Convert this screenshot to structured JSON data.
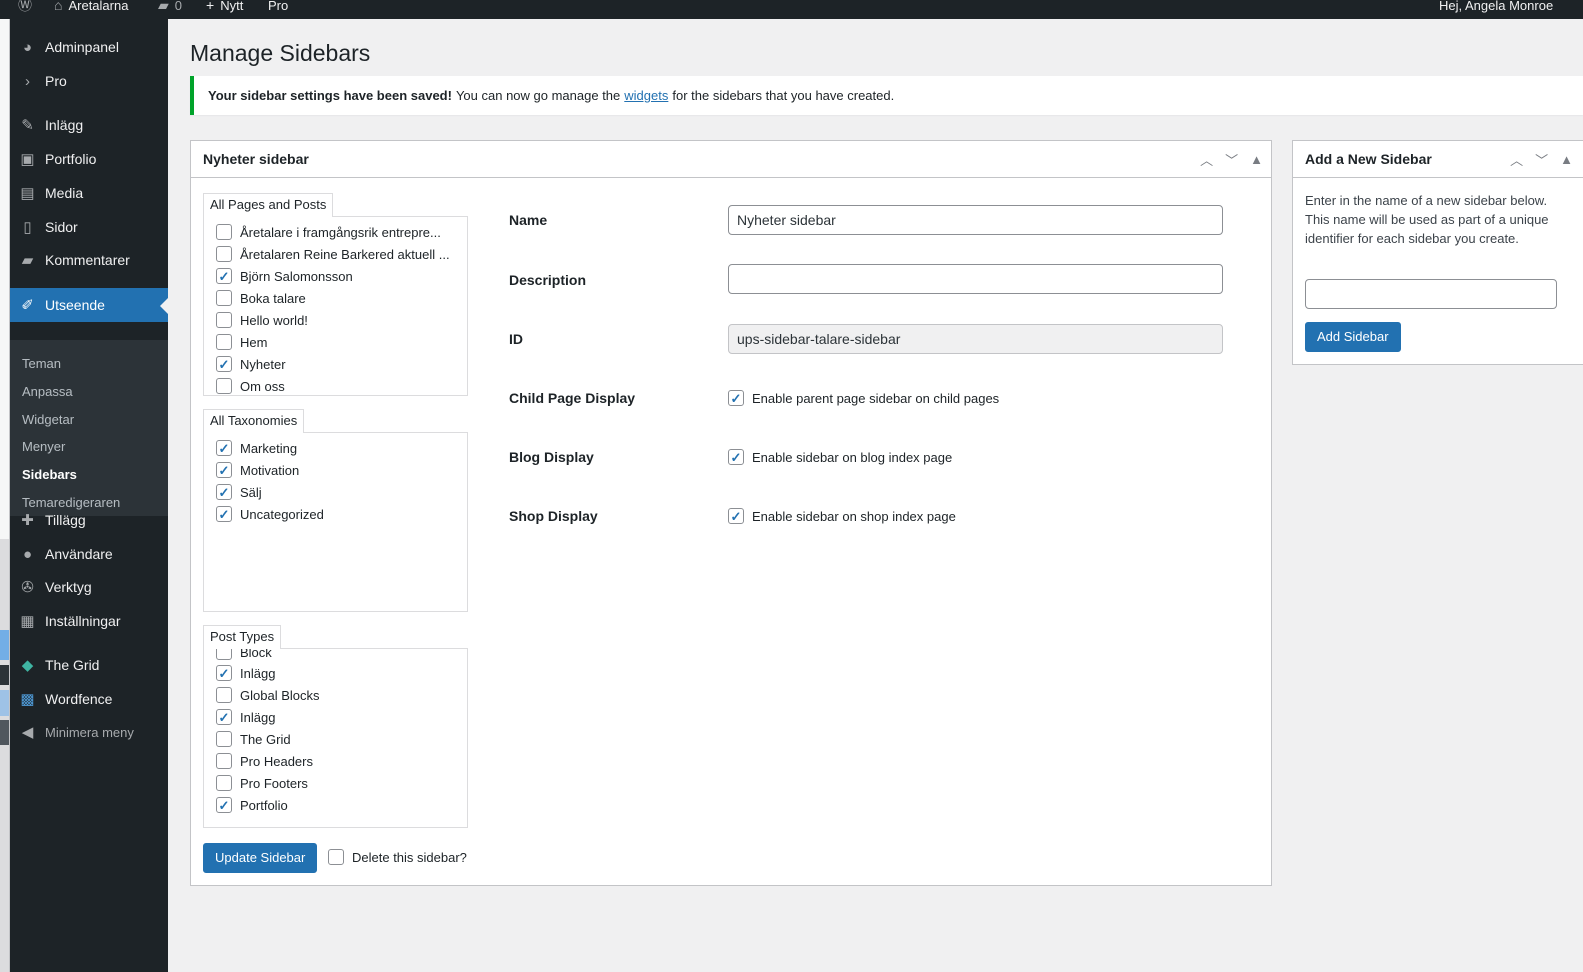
{
  "adminbar": {
    "site_name": "Aretalarna",
    "comments_count": "0",
    "new_label": "Nytt",
    "pro_label": "Pro",
    "greeting": "Hej, Angela Monroe"
  },
  "menu": {
    "items": [
      {
        "label": "Adminpanel",
        "icon": "dashboard-icon"
      },
      {
        "label": "Pro",
        "icon": "chevron-right-icon"
      },
      {
        "label": "Inlägg",
        "icon": "pin-icon"
      },
      {
        "label": "Portfolio",
        "icon": "portfolio-icon"
      },
      {
        "label": "Media",
        "icon": "media-icon"
      },
      {
        "label": "Sidor",
        "icon": "pages-icon"
      },
      {
        "label": "Kommentarer",
        "icon": "comment-icon"
      },
      {
        "label": "Utseende",
        "icon": "brush-icon"
      },
      {
        "label": "Tillägg",
        "icon": "plugin-icon"
      },
      {
        "label": "Användare",
        "icon": "user-icon"
      },
      {
        "label": "Verktyg",
        "icon": "wrench-icon"
      },
      {
        "label": "Inställningar",
        "icon": "settings-icon"
      },
      {
        "label": "The Grid",
        "icon": "grid-icon"
      },
      {
        "label": "Wordfence",
        "icon": "wordfence-icon"
      },
      {
        "label": "Minimera meny",
        "icon": "collapse-icon"
      }
    ],
    "submenu": [
      "Teman",
      "Anpassa",
      "Widgetar",
      "Menyer",
      "Sidebars",
      "Temaredigeraren"
    ],
    "active_submenu": "Sidebars"
  },
  "page": {
    "title": "Manage Sidebars"
  },
  "notice": {
    "bold": "Your sidebar settings have been saved!",
    "text_before": "You can now go manage the",
    "link": "widgets",
    "text_after": "for the sidebars that you have created."
  },
  "sidebar_box": {
    "title": "Nyheter sidebar",
    "pages_label": "All Pages and Posts",
    "pages": [
      {
        "label": "Åretalare i framgångsrik entrepre...",
        "checked": false
      },
      {
        "label": "Åretalaren Reine Barkered aktuell ...",
        "checked": false
      },
      {
        "label": "Björn Salomonsson",
        "checked": true
      },
      {
        "label": "Boka talare",
        "checked": false
      },
      {
        "label": "Hello world!",
        "checked": false
      },
      {
        "label": "Hem",
        "checked": false
      },
      {
        "label": "Nyheter",
        "checked": true
      },
      {
        "label": "Om oss",
        "checked": false
      }
    ],
    "taxonomies_label": "All Taxonomies",
    "taxonomies": [
      {
        "label": "Marketing",
        "checked": true
      },
      {
        "label": "Motivation",
        "checked": true
      },
      {
        "label": "Sälj",
        "checked": true
      },
      {
        "label": "Uncategorized",
        "checked": true
      }
    ],
    "post_types_label": "Post Types",
    "post_types": [
      {
        "label": "Block",
        "checked": false
      },
      {
        "label": "Inlägg",
        "checked": true
      },
      {
        "label": "Global Blocks",
        "checked": false
      },
      {
        "label": "Inlägg",
        "checked": true
      },
      {
        "label": "The Grid",
        "checked": false
      },
      {
        "label": "Pro Headers",
        "checked": false
      },
      {
        "label": "Pro Footers",
        "checked": false
      },
      {
        "label": "Portfolio",
        "checked": true
      }
    ],
    "fields": {
      "name_label": "Name",
      "name_value": "Nyheter sidebar",
      "description_label": "Description",
      "description_value": "",
      "id_label": "ID",
      "id_value": "ups-sidebar-talare-sidebar",
      "child_label": "Child Page Display",
      "child_option": "Enable parent page sidebar on child pages",
      "blog_label": "Blog Display",
      "blog_option": "Enable sidebar on blog index page",
      "shop_label": "Shop Display",
      "shop_option": "Enable sidebar on shop index page"
    },
    "update_button": "Update Sidebar",
    "delete_label": "Delete this sidebar?"
  },
  "new_box": {
    "title": "Add a New Sidebar",
    "description": "Enter in the name of a new sidebar below. This name will be used as part of a unique identifier for each sidebar you create.",
    "input_value": "",
    "button": "Add Sidebar"
  },
  "colors": {
    "admin_dark": "#1d2327",
    "accent": "#2271b1",
    "success": "#00a32a"
  }
}
